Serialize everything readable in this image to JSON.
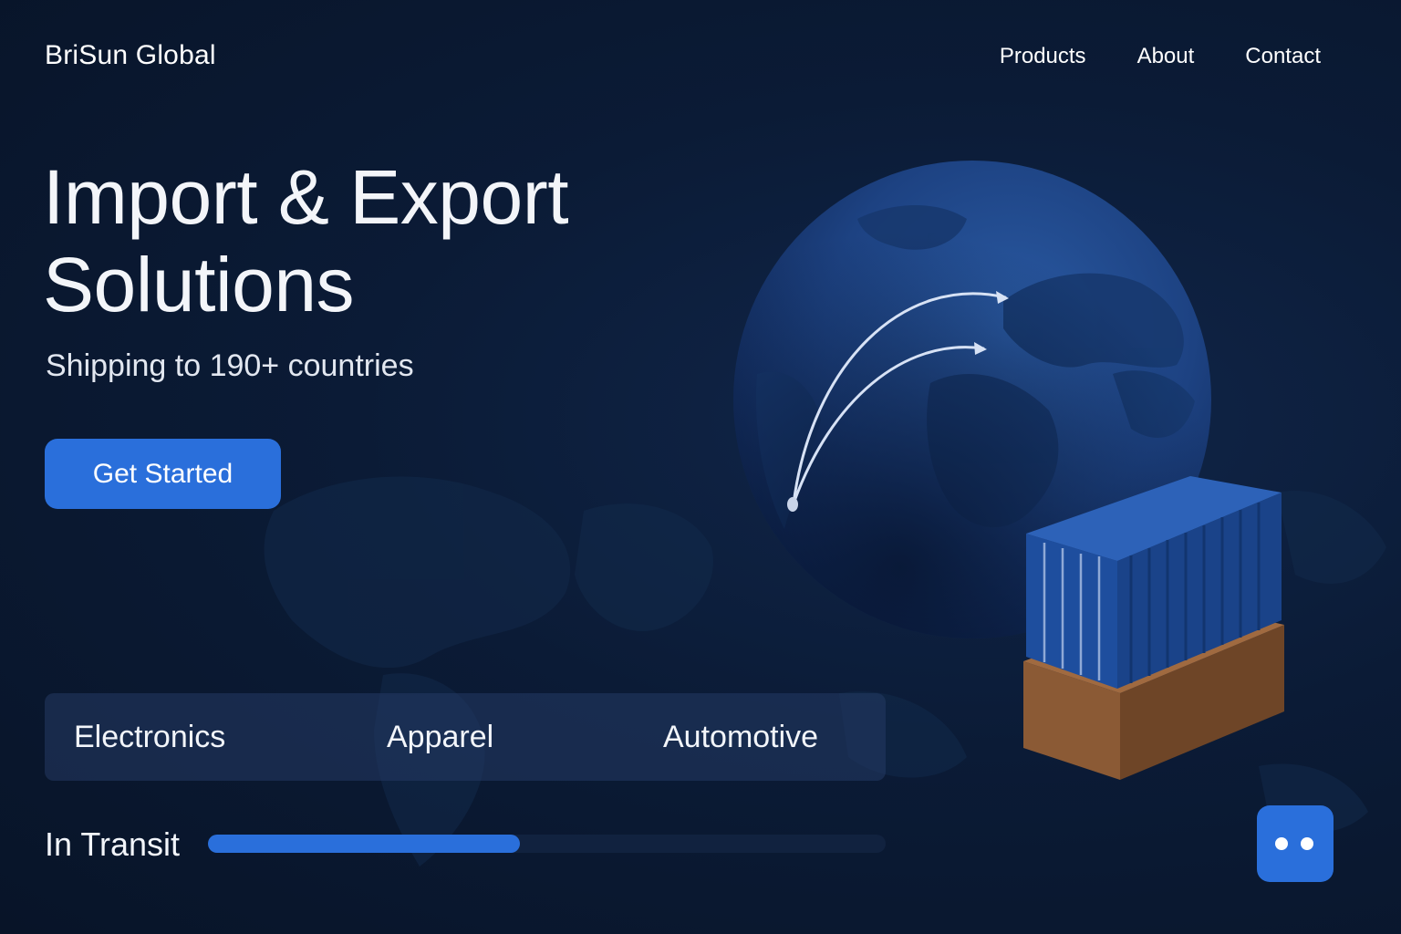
{
  "brand": "BriSun Global",
  "nav": {
    "items": [
      "Products",
      "About",
      "Contact"
    ]
  },
  "hero": {
    "title_line1": "Import & Export",
    "title_line2": "Solutions",
    "subtitle": "Shipping to 190+ countries",
    "cta_label": "Get Started"
  },
  "categories": [
    "Electronics",
    "Apparel",
    "Automotive"
  ],
  "transit": {
    "label": "In Transit",
    "progress": 0.46
  },
  "colors": {
    "accent": "#2a6fdb",
    "background": "#0b1b36",
    "globe": "#1f4684",
    "box": "#8b5a35"
  },
  "icons": {
    "chat": "chat-dots-icon"
  }
}
